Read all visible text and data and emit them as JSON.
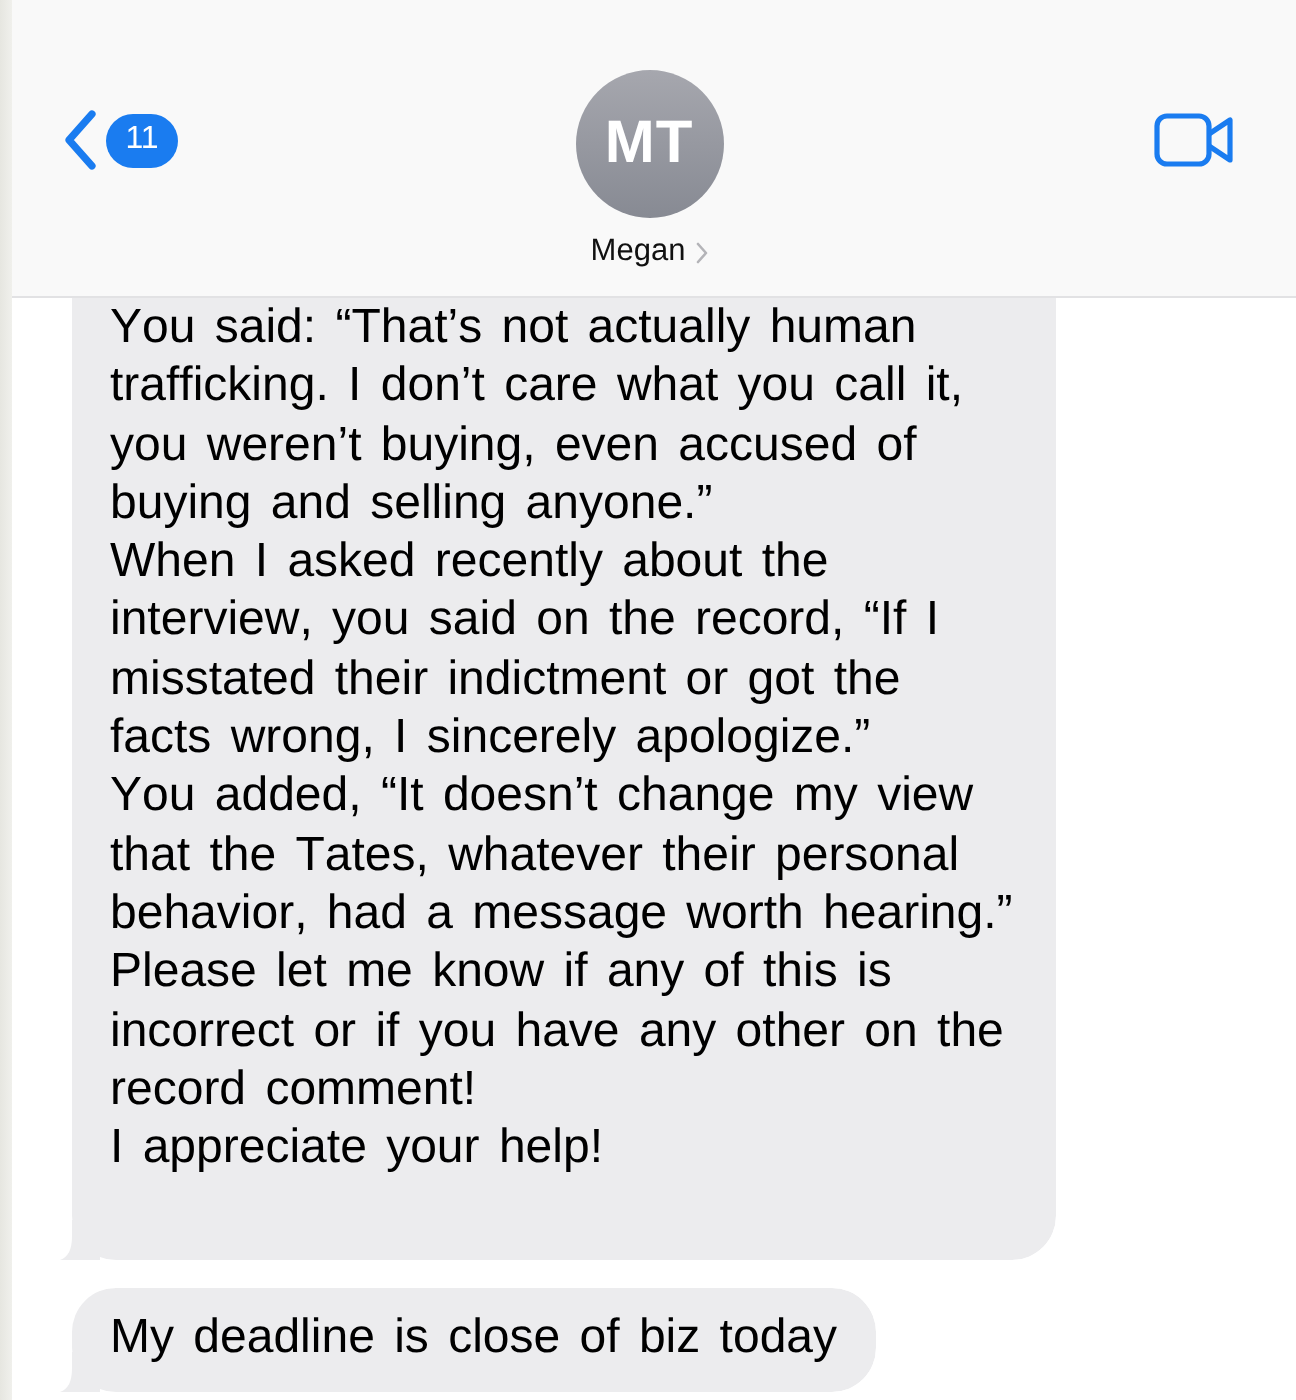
{
  "header": {
    "back_button": {
      "badge": "11"
    },
    "contact": {
      "initials": "MT",
      "name": "Megan"
    }
  },
  "messages": [
    {
      "kind": "received",
      "cut_off": true,
      "paragraphs": [
        "You said: “That’s not actually human trafficking. I don’t care what you call it, you weren’t buying, even accused of buying and selling anyone.”",
        "When I asked recently about the interview, you said on the record, “If I misstated their indictment or got the facts wrong, I sincerely apologize.”",
        "You added, “It doesn’t change my view that the Tates, whatever their personal behavior, had a message worth hearing.”",
        "Please let me know if any of this is incorrect or if you have any other on the record comment!",
        "I appreciate your help!"
      ]
    },
    {
      "kind": "received",
      "cut_off": false,
      "paragraphs": [
        "My deadline is close of biz today"
      ]
    }
  ]
}
